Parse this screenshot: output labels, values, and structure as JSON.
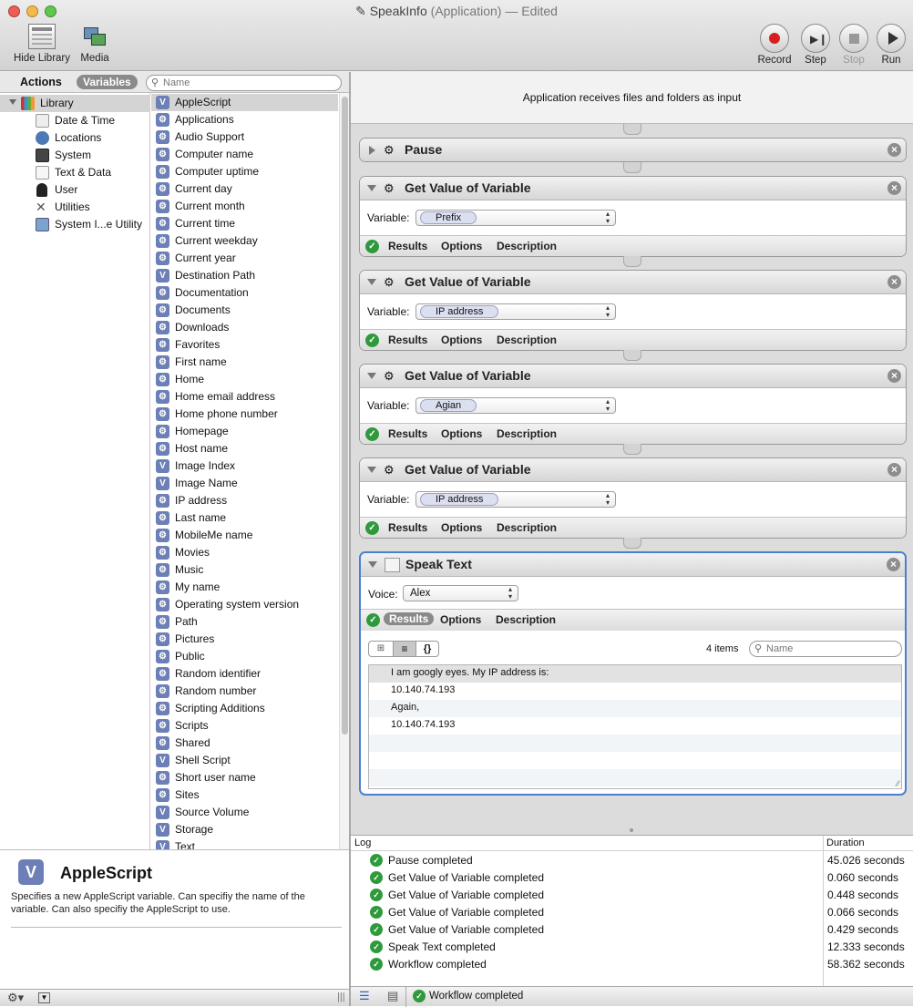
{
  "window": {
    "title": "SpeakInfo",
    "subtitle": "(Application) — Edited"
  },
  "toolbar": {
    "hide_library": "Hide Library",
    "media": "Media",
    "record": "Record",
    "step": "Step",
    "stop": "Stop",
    "run": "Run"
  },
  "library": {
    "tab_actions": "Actions",
    "tab_variables": "Variables",
    "search_placeholder": "Name",
    "categories": [
      "Library",
      "Date & Time",
      "Locations",
      "System",
      "Text & Data",
      "User",
      "Utilities",
      "System I...e Utility"
    ],
    "variables": [
      "AppleScript",
      "Applications",
      "Audio Support",
      "Computer name",
      "Computer uptime",
      "Current day",
      "Current month",
      "Current time",
      "Current weekday",
      "Current year",
      "Destination Path",
      "Documentation",
      "Documents",
      "Downloads",
      "Favorites",
      "First name",
      "Home",
      "Home email address",
      "Home phone number",
      "Homepage",
      "Host name",
      "Image Index",
      "Image Name",
      "IP address",
      "Last name",
      "MobileMe name",
      "Movies",
      "Music",
      "My name",
      "Operating system version",
      "Path",
      "Pictures",
      "Public",
      "Random identifier",
      "Random number",
      "Scripting Additions",
      "Scripts",
      "Shared",
      "Shell Script",
      "Short user name",
      "Sites",
      "Source Volume",
      "Storage",
      "Text"
    ],
    "variable_icons": [
      "V",
      "gear",
      "gear",
      "gear",
      "gear",
      "gear",
      "gear",
      "gear",
      "gear",
      "gear",
      "V",
      "gear",
      "gear",
      "gear",
      "gear",
      "gear",
      "gear",
      "gear",
      "gear",
      "gear",
      "gear",
      "V",
      "V",
      "gear",
      "gear",
      "gear",
      "gear",
      "gear",
      "gear",
      "gear",
      "gear",
      "gear",
      "gear",
      "gear",
      "gear",
      "gear",
      "gear",
      "gear",
      "V",
      "gear",
      "gear",
      "V",
      "V",
      "V"
    ]
  },
  "info": {
    "title": "AppleScript",
    "description": "Specifies a new AppleScript variable. Can specifiy the name of the variable. Can also specifiy the AppleScript to use."
  },
  "workflow": {
    "input_label": "Application receives files and folders as input",
    "variable_label": "Variable:",
    "voice_label": "Voice:",
    "results_label": "Results",
    "options_label": "Options",
    "description_label": "Description",
    "actions": [
      {
        "title": "Pause"
      },
      {
        "title": "Get Value of Variable",
        "variable": "Prefix"
      },
      {
        "title": "Get Value of Variable",
        "variable": "IP address"
      },
      {
        "title": "Get Value of Variable",
        "variable": "Agian"
      },
      {
        "title": "Get Value of Variable",
        "variable": "IP address"
      },
      {
        "title": "Speak Text",
        "voice": "Alex"
      }
    ],
    "results": {
      "count": "4 items",
      "search_placeholder": "Name",
      "items": [
        "I am googly eyes. My IP address is:",
        "10.140.74.193",
        "Again,",
        "10.140.74.193"
      ]
    }
  },
  "log": {
    "col_log": "Log",
    "col_duration": "Duration",
    "rows": [
      {
        "text": "Pause completed",
        "duration": "45.026 seconds"
      },
      {
        "text": "Get Value of Variable completed",
        "duration": "0.060 seconds"
      },
      {
        "text": "Get Value of Variable completed",
        "duration": "0.448 seconds"
      },
      {
        "text": "Get Value of Variable completed",
        "duration": "0.066 seconds"
      },
      {
        "text": "Get Value of Variable completed",
        "duration": "0.429 seconds"
      },
      {
        "text": "Speak Text completed",
        "duration": "12.333 seconds"
      },
      {
        "text": "Workflow completed",
        "duration": "58.362 seconds"
      }
    ],
    "status": "Workflow completed"
  }
}
